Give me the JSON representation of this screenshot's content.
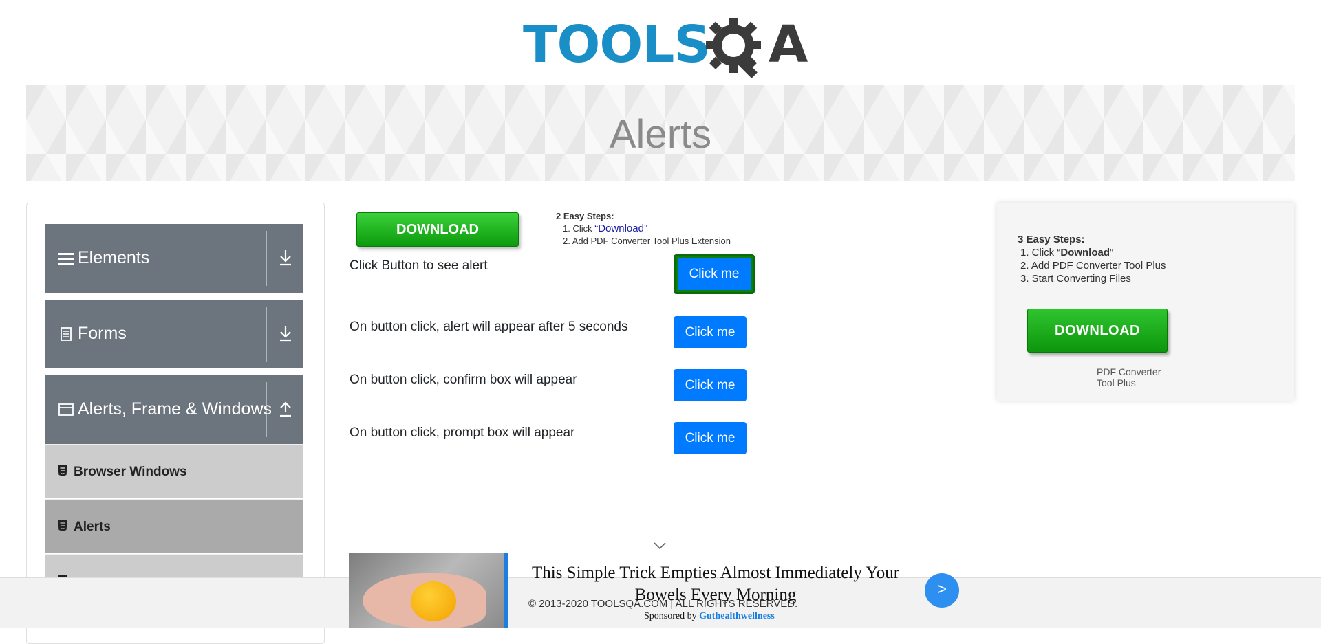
{
  "logo": {
    "text_main": "TOOLS",
    "text_end": "A"
  },
  "banner": {
    "title": "Alerts"
  },
  "sidebar": {
    "groups": [
      {
        "label": "Elements",
        "icon": "hamburger-icon"
      },
      {
        "label": "Forms",
        "icon": "document-icon"
      },
      {
        "label": "Alerts, Frame & Windows",
        "icon": "window-icon"
      }
    ],
    "items": [
      {
        "label": "Browser Windows"
      },
      {
        "label": "Alerts"
      }
    ]
  },
  "top_ad": {
    "download_label": "DOWNLOAD",
    "steps_heading": "2 Easy Steps:",
    "step1_prefix": "1. Click ",
    "step1_link": "“Download”",
    "step2": "2. Add PDF Converter Tool Plus Extension"
  },
  "alerts": {
    "rows": [
      {
        "text": "Click Button to see alert",
        "button": "Click me"
      },
      {
        "text": "On button click, alert will appear after 5 seconds",
        "button": "Click me"
      },
      {
        "text": "On button click, confirm box will appear",
        "button": "Click me"
      },
      {
        "text": "On button click, prompt box will appear",
        "button": "Click me"
      }
    ]
  },
  "right_ad": {
    "heading": "3 Easy Steps:",
    "step1_prefix": "1. Click “",
    "step1_bold": "Download",
    "step1_suffix": "”",
    "step2": "2. Add PDF Converter Tool Plus",
    "step3": "3. Start Converting Files",
    "download_label": "DOWNLOAD",
    "product_line1": "PDF Converter",
    "product_line2": "Tool Plus"
  },
  "footer": {
    "copyright": "© 2013-2020 TOOLSQA.COM | ALL RIGHTS RESERVED."
  },
  "bottom_ad": {
    "title": "This Simple Trick Empties Almost Immediately Your Bowels Every Morning",
    "sponsored_prefix": "Sponsored by ",
    "sponsor": "Guthealthwellness",
    "next_label": ">"
  }
}
